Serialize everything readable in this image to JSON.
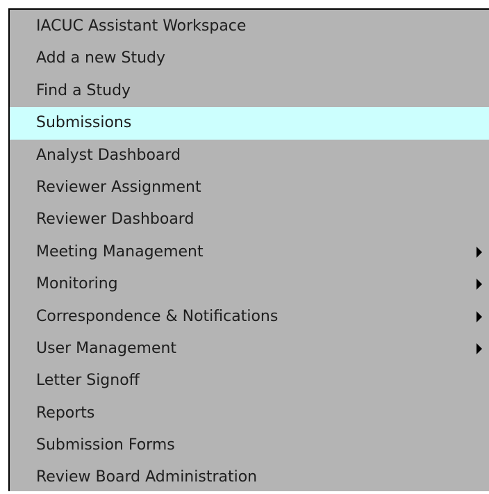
{
  "menu": {
    "items": [
      {
        "label": "IACUC Assistant Workspace",
        "active": false,
        "has_submenu": false
      },
      {
        "label": "Add a new Study",
        "active": false,
        "has_submenu": false
      },
      {
        "label": "Find a Study",
        "active": false,
        "has_submenu": false
      },
      {
        "label": "Submissions",
        "active": true,
        "has_submenu": false
      },
      {
        "label": "Analyst Dashboard",
        "active": false,
        "has_submenu": false
      },
      {
        "label": "Reviewer Assignment",
        "active": false,
        "has_submenu": false
      },
      {
        "label": "Reviewer Dashboard",
        "active": false,
        "has_submenu": false
      },
      {
        "label": "Meeting Management",
        "active": false,
        "has_submenu": true
      },
      {
        "label": "Monitoring",
        "active": false,
        "has_submenu": true
      },
      {
        "label": "Correspondence & Notifications",
        "active": false,
        "has_submenu": true
      },
      {
        "label": "User Management",
        "active": false,
        "has_submenu": true
      },
      {
        "label": "Letter Signoff",
        "active": false,
        "has_submenu": false
      },
      {
        "label": "Reports",
        "active": false,
        "has_submenu": false
      },
      {
        "label": "Submission Forms",
        "active": false,
        "has_submenu": false
      },
      {
        "label": "Review Board Administration",
        "active": false,
        "has_submenu": false
      }
    ],
    "colors": {
      "background": "#b4b4b4",
      "active_background": "#ccfffe",
      "text": "#1e1e1e",
      "arrow": "#000000"
    }
  }
}
